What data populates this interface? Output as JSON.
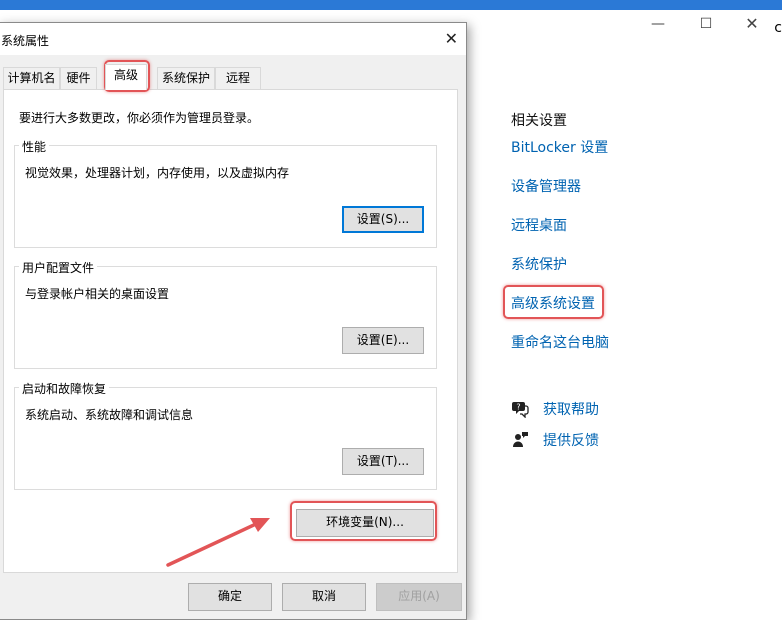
{
  "settings": {
    "edge_char": "c",
    "related_title": "相关设置",
    "links": [
      {
        "label": "BitLocker 设置"
      },
      {
        "label": "设备管理器"
      },
      {
        "label": "远程桌面"
      },
      {
        "label": "系统保护"
      },
      {
        "label": "高级系统设置"
      },
      {
        "label": "重命名这台电脑"
      }
    ],
    "help": {
      "label": "获取帮助",
      "icon": "help-chat-icon"
    },
    "feedback": {
      "label": "提供反馈",
      "icon": "feedback-person-icon"
    },
    "accent": "#0063b1"
  },
  "dialog": {
    "title": "系统属性",
    "tabs": [
      "计算机名",
      "硬件",
      "高级",
      "系统保护",
      "远程"
    ],
    "active_tab": "高级",
    "note": "要进行大多数更改，你必须作为管理员登录。",
    "groups": [
      {
        "label": "性能",
        "desc": "视觉效果，处理器计划，内存使用，以及虚拟内存",
        "button": "设置(S)..."
      },
      {
        "label": "用户配置文件",
        "desc": "与登录帐户相关的桌面设置",
        "button": "设置(E)..."
      },
      {
        "label": "启动和故障恢复",
        "desc": "系统启动、系统故障和调试信息",
        "button": "设置(T)..."
      }
    ],
    "env_button": "环境变量(N)...",
    "ok": "确定",
    "cancel": "取消",
    "apply": "应用(A)"
  },
  "annotation_color": "#e25557"
}
